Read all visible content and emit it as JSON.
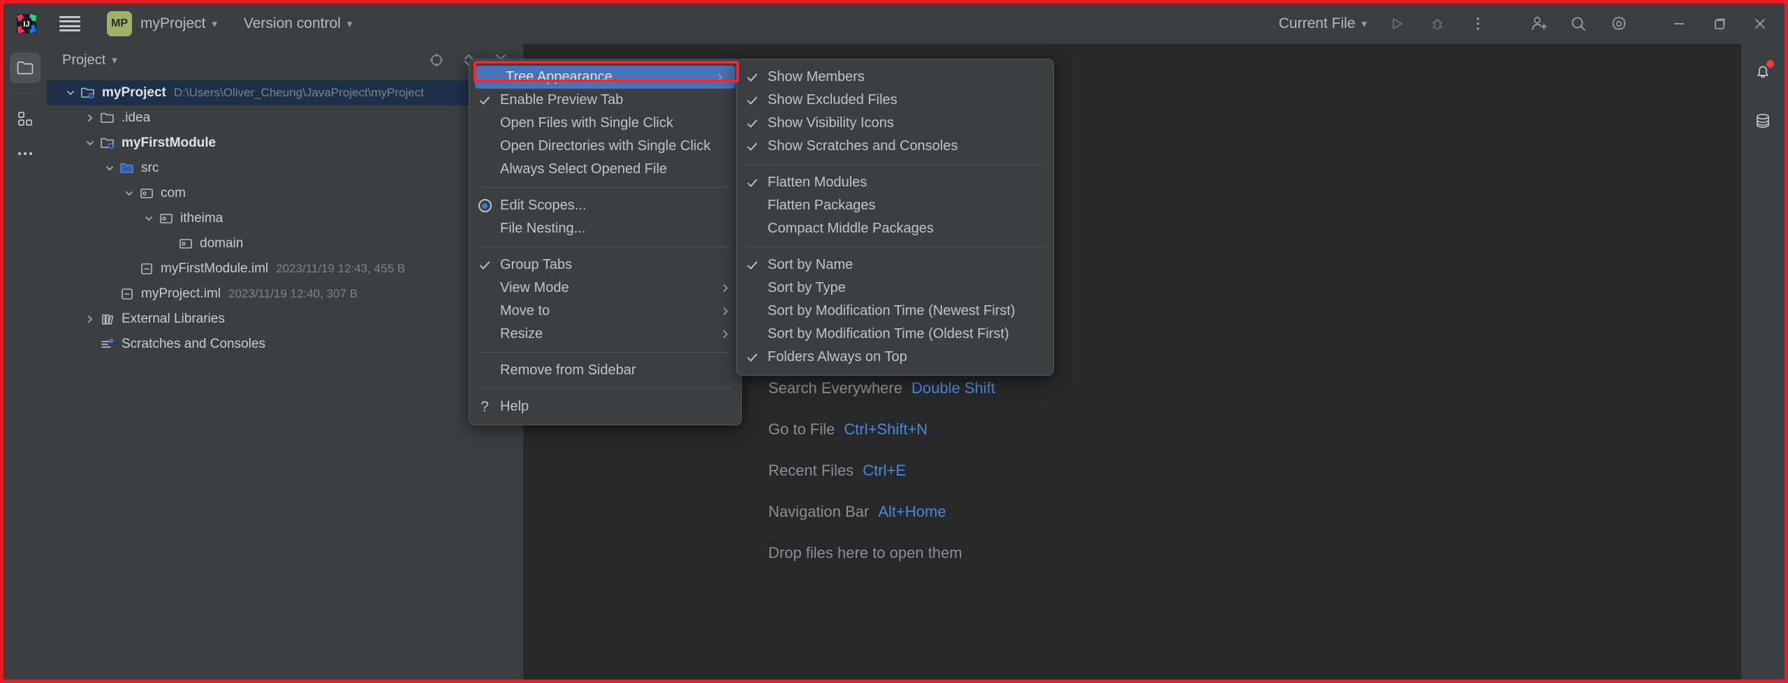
{
  "window": {
    "app_icon": "intellij-idea-icon",
    "menu_icon": "hamburger-menu-icon",
    "project_badge": "MP",
    "project_name": "myProject",
    "version_control": "Version control",
    "run_config": "Current File",
    "icons": {
      "run": "run-icon",
      "debug": "debug-icon",
      "more": "more-vertical-icon",
      "account": "add-account-icon",
      "search": "search-icon",
      "settings": "gear-icon",
      "minimize": "minimize-icon",
      "maximize": "maximize-icon",
      "close": "close-icon"
    }
  },
  "left_bar": {
    "items": [
      {
        "name": "project-icon",
        "active": true
      },
      {
        "name": "structure-icon",
        "active": false
      },
      {
        "name": "more-tool-windows-icon",
        "active": false
      }
    ]
  },
  "right_bar": {
    "items": [
      {
        "name": "notifications-icon",
        "badge": true
      },
      {
        "name": "database-icon",
        "badge": false
      }
    ]
  },
  "tool_window": {
    "title": "Project",
    "actions": [
      {
        "name": "select-opened-file-icon"
      },
      {
        "name": "expand-collapse-icon"
      },
      {
        "name": "collapse-all-icon"
      }
    ],
    "tree": [
      {
        "indent": 0,
        "arrow": "down",
        "icon": "module-folder-icon",
        "label": "myProject",
        "bold": true,
        "meta": "D:\\Users\\Oliver_Cheung\\JavaProject\\myProject",
        "selected": true
      },
      {
        "indent": 1,
        "arrow": "right",
        "icon": "folder-icon",
        "label": ".idea",
        "bold": false,
        "meta": "",
        "selected": false
      },
      {
        "indent": 1,
        "arrow": "down",
        "icon": "module-folder-icon",
        "label": "myFirstModule",
        "bold": true,
        "meta": "",
        "selected": false
      },
      {
        "indent": 2,
        "arrow": "down",
        "icon": "source-folder-icon",
        "label": "src",
        "bold": false,
        "meta": "",
        "selected": false
      },
      {
        "indent": 3,
        "arrow": "down",
        "icon": "package-icon",
        "label": "com",
        "bold": false,
        "meta": "",
        "selected": false
      },
      {
        "indent": 4,
        "arrow": "down",
        "icon": "package-icon",
        "label": "itheima",
        "bold": false,
        "meta": "",
        "selected": false
      },
      {
        "indent": 5,
        "arrow": "none",
        "icon": "package-icon",
        "label": "domain",
        "bold": false,
        "meta": "",
        "selected": false
      },
      {
        "indent": 3,
        "arrow": "none",
        "icon": "iml-file-icon",
        "label": "myFirstModule.iml",
        "bold": false,
        "meta": "2023/11/19 12:43, 455 B",
        "selected": false
      },
      {
        "indent": 2,
        "arrow": "none",
        "icon": "iml-file-icon",
        "label": "myProject.iml",
        "bold": false,
        "meta": "2023/11/19 12:40, 307 B",
        "selected": false
      },
      {
        "indent": 1,
        "arrow": "right",
        "icon": "external-libraries-icon",
        "label": "External Libraries",
        "bold": false,
        "meta": "",
        "selected": false
      },
      {
        "indent": 1,
        "arrow": "none",
        "icon": "scratches-icon",
        "label": "Scratches and Consoles",
        "bold": false,
        "meta": "",
        "selected": false
      }
    ]
  },
  "editor": {
    "hints": [
      {
        "label": "Search Everywhere",
        "key": "Double Shift"
      },
      {
        "label": "Go to File",
        "key": "Ctrl+Shift+N"
      },
      {
        "label": "Recent Files",
        "key": "Ctrl+E"
      },
      {
        "label": "Navigation Bar",
        "key": "Alt+Home"
      }
    ],
    "drop_text": "Drop files here to open them"
  },
  "context_menu": {
    "items": [
      {
        "label": "Tree Appearance",
        "check": "none",
        "arrow": true,
        "highlight": true
      },
      {
        "label": "Enable Preview Tab",
        "check": "tick",
        "arrow": false,
        "highlight": false
      },
      {
        "label": "Open Files with Single Click",
        "check": "none",
        "arrow": false,
        "highlight": false
      },
      {
        "label": "Open Directories with Single Click",
        "check": "none",
        "arrow": false,
        "highlight": false
      },
      {
        "label": "Always Select Opened File",
        "check": "none",
        "arrow": false,
        "highlight": false
      },
      {
        "separator": true
      },
      {
        "label": "Edit Scopes...",
        "check": "radio",
        "arrow": false,
        "highlight": false
      },
      {
        "label": "File Nesting...",
        "check": "none",
        "arrow": false,
        "highlight": false
      },
      {
        "separator": true
      },
      {
        "label": "Group Tabs",
        "check": "tick",
        "arrow": false,
        "highlight": false
      },
      {
        "label": "View Mode",
        "check": "none",
        "arrow": true,
        "highlight": false
      },
      {
        "label": "Move to",
        "check": "none",
        "arrow": true,
        "highlight": false
      },
      {
        "label": "Resize",
        "check": "none",
        "arrow": true,
        "highlight": false
      },
      {
        "separator": true
      },
      {
        "label": "Remove from Sidebar",
        "check": "none",
        "arrow": false,
        "highlight": false
      },
      {
        "separator": true
      },
      {
        "label": "Help",
        "check": "question",
        "arrow": false,
        "highlight": false
      }
    ]
  },
  "submenu": {
    "items": [
      {
        "label": "Show Members",
        "check": "tick"
      },
      {
        "label": "Show Excluded Files",
        "check": "tick"
      },
      {
        "label": "Show Visibility Icons",
        "check": "tick"
      },
      {
        "label": "Show Scratches and Consoles",
        "check": "tick"
      },
      {
        "separator": true
      },
      {
        "label": "Flatten Modules",
        "check": "tick"
      },
      {
        "label": "Flatten Packages",
        "check": "none"
      },
      {
        "label": "Compact Middle Packages",
        "check": "none"
      },
      {
        "separator": true
      },
      {
        "label": "Sort by Name",
        "check": "tick"
      },
      {
        "label": "Sort by Type",
        "check": "none"
      },
      {
        "label": "Sort by Modification Time (Newest First)",
        "check": "none"
      },
      {
        "label": "Sort by Modification Time (Oldest First)",
        "check": "none"
      },
      {
        "label": "Folders Always on Top",
        "check": "tick"
      }
    ]
  },
  "colors": {
    "accent_highlight": "#4a72b8",
    "annotation_red": "#ef2a2a",
    "shortcut_blue": "#4a88df",
    "panel_bg": "#3c3f41",
    "editor_bg": "#262829",
    "badge_green": "#9fb26b"
  }
}
